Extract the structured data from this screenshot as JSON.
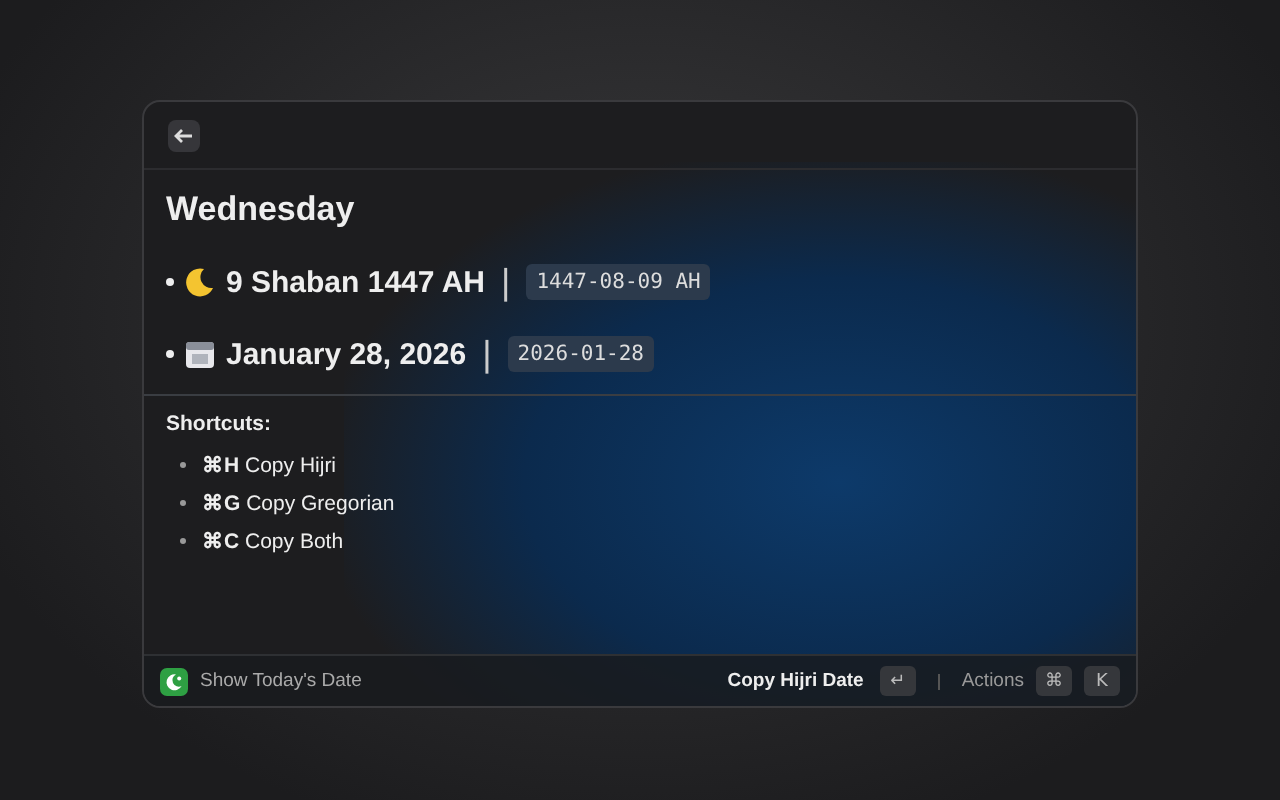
{
  "heading": "Wednesday",
  "dates": [
    {
      "kind": "hijri",
      "text": "9 Shaban 1447 AH",
      "separator": "|",
      "code": "1447-08-09 AH"
    },
    {
      "kind": "gregorian",
      "text": "January 28, 2026",
      "separator": "|",
      "code": "2026-01-28"
    }
  ],
  "shortcuts_title": "Shortcuts:",
  "shortcuts": [
    "**⌘H** Copy Hijri",
    "**⌘G** Copy Gregorian",
    "**⌘C** Copy Both"
  ],
  "footer": {
    "command": "Show Today's Date",
    "primary_action": "Copy Hijri Date",
    "primary_key": "↵",
    "actions_label": "Actions",
    "action_keys": [
      "⌘",
      "K"
    ]
  }
}
